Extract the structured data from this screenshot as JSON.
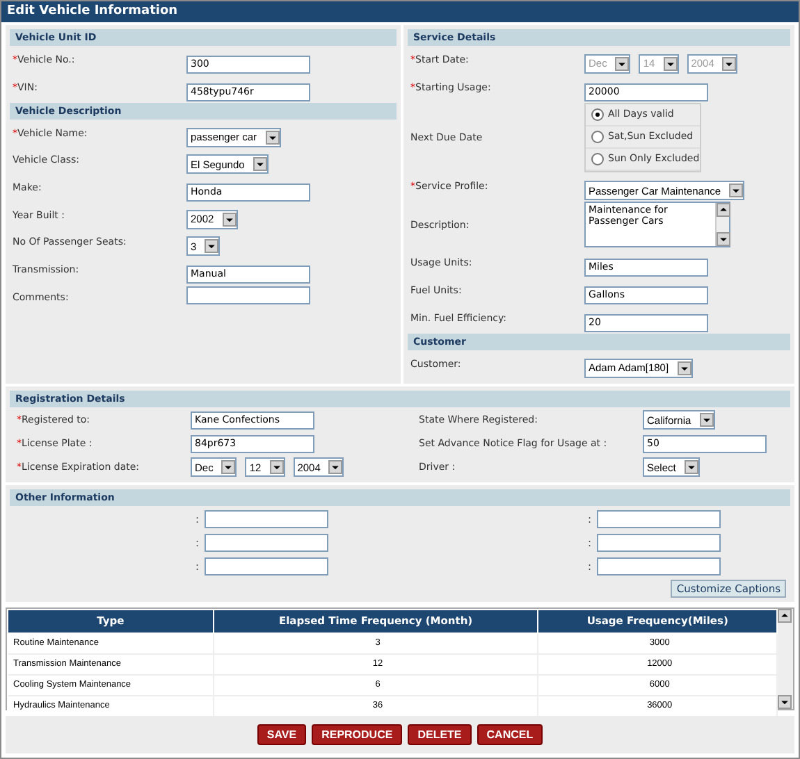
{
  "window": {
    "title": "Edit Vehicle Information"
  },
  "left_sections": [
    {
      "heading": "Vehicle Unit ID",
      "fields": [
        {
          "kind": "text",
          "mark": "*",
          "label": "Vehicle No.:",
          "value": "300"
        },
        {
          "kind": "text",
          "mark": "*",
          "label": "VIN:",
          "value": "458typu746r"
        }
      ]
    },
    {
      "heading": "Vehicle Description",
      "fields": [
        {
          "kind": "select",
          "mark": "*",
          "label": "Vehicle Name:",
          "value": "passenger car"
        },
        {
          "kind": "select",
          "label": "Vehicle Class:",
          "value": "El Segundo"
        },
        {
          "kind": "text",
          "label": "Make:",
          "value": "Honda"
        },
        {
          "kind": "select",
          "label": "Year Built :",
          "value": "2002"
        },
        {
          "kind": "select",
          "label": "No Of Passenger Seats:",
          "value": "3"
        },
        {
          "kind": "text",
          "label": "Transmission:",
          "value": "Manual"
        },
        {
          "kind": "text",
          "label": "Comments:"
        }
      ]
    }
  ],
  "right_sections": [
    {
      "heading": "Service Details",
      "fields": [
        {
          "kind": "date",
          "mark": "*",
          "label": "Start Date:",
          "disabled": true,
          "parts": [
            "Dec",
            "14",
            "2004"
          ]
        },
        {
          "kind": "text",
          "mark": "*",
          "label": "Starting Usage:",
          "value": "20000"
        },
        {
          "kind": "radio",
          "label": "Next Due Date",
          "options": [
            {
              "label": "All Days valid",
              "selected": true
            },
            {
              "label": "Sat,Sun Excluded",
              "selected": false
            },
            {
              "label": "Sun Only Excluded",
              "selected": false
            }
          ]
        },
        {
          "kind": "select",
          "mark": "*",
          "label": "Service Profile:",
          "value": "Passenger Car Maintenance"
        },
        {
          "kind": "textarea",
          "label": "Description:",
          "value": "Maintenance for Passenger Cars"
        },
        {
          "kind": "text",
          "label": "Usage Units:",
          "value": "Miles"
        },
        {
          "kind": "text",
          "label": "Fuel Units:",
          "value": "Gallons"
        },
        {
          "kind": "text",
          "label": "Min. Fuel Efficiency:",
          "value": "20"
        }
      ]
    },
    {
      "heading": "Customer",
      "fields": [
        {
          "kind": "select",
          "label": "Customer:",
          "value": "Adam Adam[180]"
        }
      ]
    }
  ],
  "registration": {
    "heading": "Registration Details",
    "fields": [
      {
        "kind": "text",
        "mark": "*",
        "label": "Registered to:",
        "value": "Kane Confections"
      },
      {
        "kind": "select",
        "label": "State Where Registered:",
        "value": "California"
      },
      {
        "kind": "text",
        "mark": "*",
        "label": "License Plate :",
        "value": "84pr673"
      },
      {
        "kind": "text",
        "label": "Set Advance Notice Flag for Usage at :",
        "value": "50"
      },
      {
        "kind": "date",
        "mark": "*",
        "label": "License Expiration date:",
        "disabled": false,
        "parts": [
          "Dec",
          "12",
          "2004"
        ]
      },
      {
        "kind": "select",
        "label": "Driver :",
        "value": "Select"
      }
    ]
  },
  "other_information": {
    "heading": "Other Information",
    "fields": [
      {
        "kind": "text",
        "label": ":"
      },
      {
        "kind": "text",
        "label": ":"
      },
      {
        "kind": "text",
        "label": ":"
      },
      {
        "kind": "text",
        "label": ":"
      },
      {
        "kind": "text",
        "label": ":"
      },
      {
        "kind": "text",
        "label": ":"
      }
    ]
  },
  "customize_button": "Customize Captions",
  "table": {
    "columns": [
      "Type",
      "Elapsed Time Frequency (Month)",
      "Usage Frequency(Miles)"
    ],
    "rows": [
      [
        "Routine Maintenance",
        "3",
        "3000"
      ],
      [
        "Transmission Maintenance",
        "12",
        "12000"
      ],
      [
        "Cooling System Maintenance",
        "6",
        "6000"
      ],
      [
        "Hydraulics Maintenance",
        "36",
        "36000"
      ]
    ]
  },
  "buttons": [
    "SAVE",
    "REPRODUCE",
    "DELETE",
    "CANCEL"
  ]
}
